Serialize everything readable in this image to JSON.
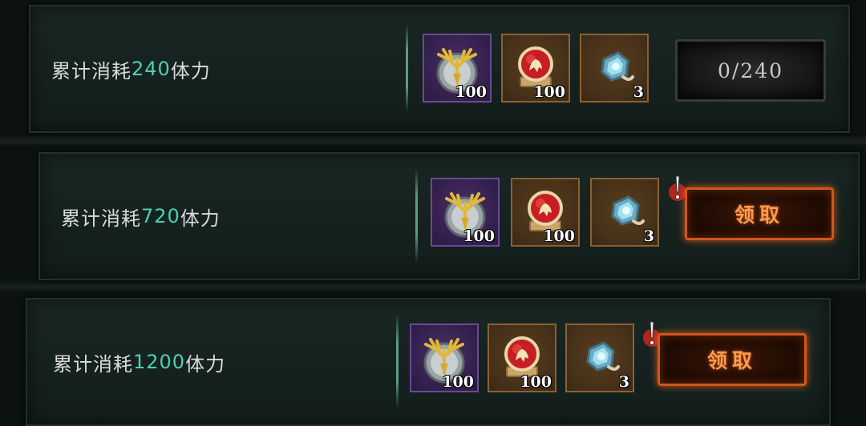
{
  "quests": [
    {
      "prefix": "累计消耗",
      "amount": "240",
      "suffix": "体力",
      "rewards": [
        {
          "icon": "gold-antler-emblem-icon",
          "count": "100",
          "rarity": "purple"
        },
        {
          "icon": "red-lion-medal-icon",
          "count": "100",
          "rarity": "orange"
        },
        {
          "icon": "blue-gem-stone-icon",
          "count": "3",
          "rarity": "orange"
        }
      ],
      "action": {
        "type": "progress",
        "label": "0/240"
      }
    },
    {
      "prefix": "累计消耗",
      "amount": "720",
      "suffix": "体力",
      "rewards": [
        {
          "icon": "gold-antler-emblem-icon",
          "count": "100",
          "rarity": "purple"
        },
        {
          "icon": "red-lion-medal-icon",
          "count": "100",
          "rarity": "orange"
        },
        {
          "icon": "blue-gem-stone-icon",
          "count": "3",
          "rarity": "orange"
        }
      ],
      "action": {
        "type": "claim",
        "label": "领取",
        "alert": true
      }
    },
    {
      "prefix": "累计消耗",
      "amount": "1200",
      "suffix": "体力",
      "rewards": [
        {
          "icon": "gold-antler-emblem-icon",
          "count": "100",
          "rarity": "purple"
        },
        {
          "icon": "red-lion-medal-icon",
          "count": "100",
          "rarity": "orange"
        },
        {
          "icon": "blue-gem-stone-icon",
          "count": "3",
          "rarity": "orange"
        }
      ],
      "action": {
        "type": "claim",
        "label": "领取",
        "alert": true
      }
    }
  ],
  "colors": {
    "amount": "#4fcfb0",
    "claim_text": "#ff9b4a",
    "claim_border": "#d2571a",
    "purple_slot": "#33204d",
    "orange_slot": "#45301a"
  }
}
